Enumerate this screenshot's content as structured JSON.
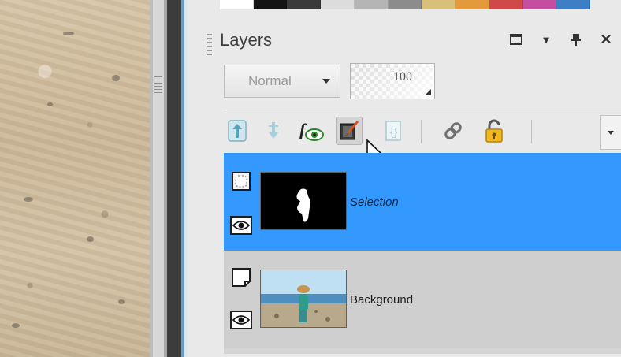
{
  "panel": {
    "title": "Layers",
    "swatch_colors": [
      "#ffffff",
      "#141414",
      "#3a3a3a",
      "#dcdcdc",
      "#b5b5b5",
      "#8c8c8c",
      "#d8c07a",
      "#e39a3a",
      "#d04848",
      "#c44fa0",
      "#3d7ec4"
    ]
  },
  "window_buttons": {
    "maximize": "maximize-icon",
    "dropdown": "▾",
    "pin": "⊥",
    "close": "✕"
  },
  "blend": {
    "mode": "Normal",
    "opacity": "100"
  },
  "toolbar": {
    "tools": [
      {
        "name": "move-layer-up",
        "icon": "arrow-up-icon"
      },
      {
        "name": "move-layer-down",
        "icon": "arrow-down-icon"
      },
      {
        "name": "layer-effects",
        "icon": "fx-eye-icon"
      },
      {
        "name": "edit-mask",
        "icon": "mask-brush-icon"
      },
      {
        "name": "layer-properties",
        "icon": "bracket-doc-icon"
      },
      {
        "name": "link-layers",
        "icon": "chain-link-icon"
      },
      {
        "name": "lock-layer",
        "icon": "padlock-icon"
      }
    ]
  },
  "layers": [
    {
      "name": "Selection",
      "selected": true
    },
    {
      "name": "Background",
      "selected": false
    }
  ]
}
